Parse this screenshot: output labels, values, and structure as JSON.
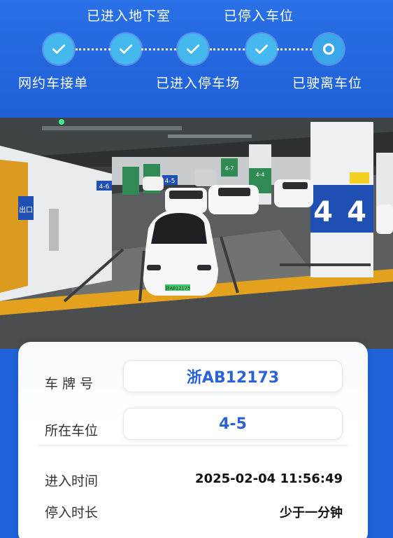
{
  "progress": {
    "steps": [
      {
        "label": "网约车接单",
        "status": "done"
      },
      {
        "label": "已进入地下室",
        "status": "done"
      },
      {
        "label": "已进入停车场",
        "status": "done"
      },
      {
        "label": "已停入车位",
        "status": "done"
      },
      {
        "label": "已驶离车位",
        "status": "current"
      }
    ]
  },
  "photo": {
    "signs": {
      "exit": "出口",
      "space_4_6": "4-6",
      "space_4_5": "4-5",
      "space_4_4": "4-4",
      "space_4_7": "4-7",
      "pillar_left": "4",
      "pillar_right": "4",
      "plate": "浙AB12173"
    }
  },
  "info": {
    "plate_label": "车 牌 号",
    "plate_value": "浙AB12173",
    "space_label": "所在车位",
    "space_value": "4-5",
    "entry_time_label": "进入时间",
    "entry_time_value": "2025-02-04 11:56:49",
    "duration_label": "停入时长",
    "duration_value": "少于一分钟"
  },
  "colors": {
    "header_blue": "#1f62d9",
    "step_done": "#46b8f0",
    "value_blue": "#2a63d8"
  }
}
